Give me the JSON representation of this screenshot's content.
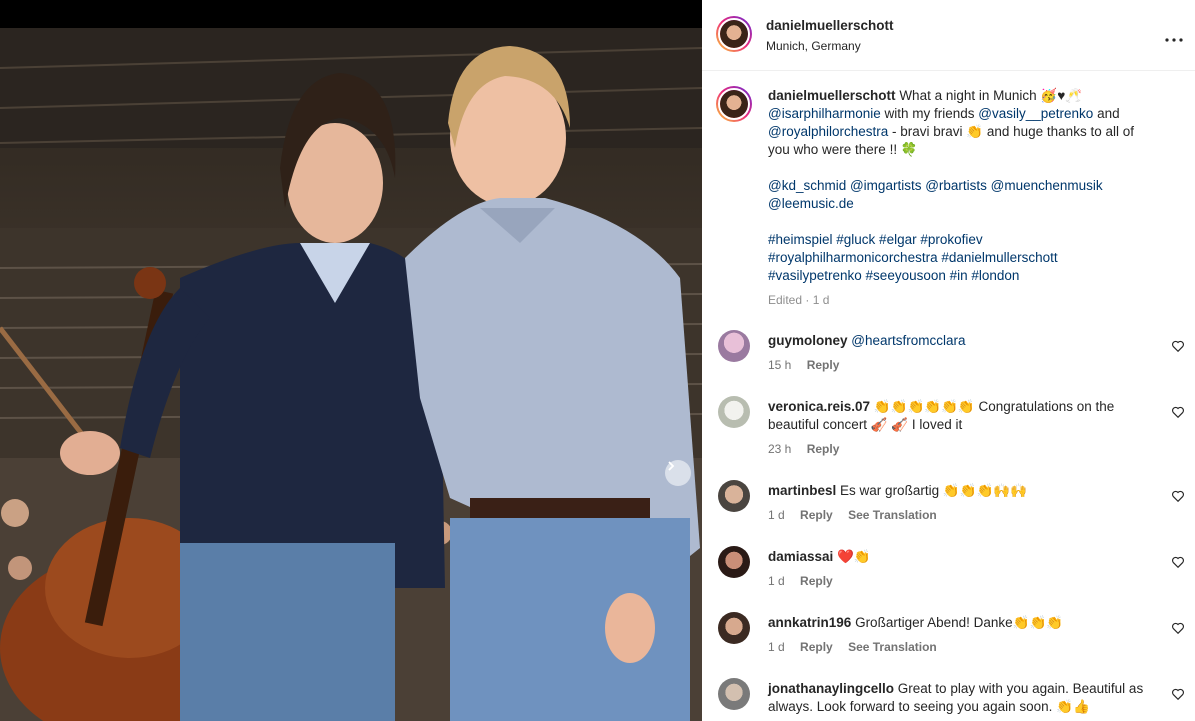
{
  "post": {
    "username": "danielmuellerschott",
    "location": "Munich, Germany",
    "more_icon": "more-horizontal-icon",
    "caption": {
      "username": "danielmuellerschott",
      "line1_text": "What a night in Munich",
      "line1_emoji": "🥳♥🥂",
      "mention_isar": "@isarphilharmonie",
      "with_friends": " with my friends ",
      "mention_vasily": "@vasily__petrenko",
      "and": " and",
      "mention_rpo": "@royalphilorchestra",
      "bravi": " - bravi bravi ",
      "clap": "👏",
      "huge_thanks": " and huge thanks to all of",
      "line4": "you who were there !! ",
      "clover": "🍀",
      "tags1": "@kd_schmid @imgartists @rbartists @muenchenmusik",
      "tags2": "@leemusic.de",
      "hashtags1": "#heimspiel #gluck #elgar #prokofiev",
      "hashtags2": "#royalphilharmonicorchestra #danielmullerschott",
      "hashtags3": "#vasilypetrenko #seeyousoon #in #london",
      "edited": "Edited · 1 d"
    }
  },
  "comments": [
    {
      "user": "guymoloney",
      "text_mention": "@heartsfromcclara",
      "text": "",
      "time": "15 h",
      "reply": "Reply",
      "translate": ""
    },
    {
      "user": "veronica.reis.07",
      "text": "👏👏👏👏👏👏 Congratulations on the",
      "text2": "beautiful concert 🎻 🎻 I loved it",
      "time": "23 h",
      "reply": "Reply",
      "translate": ""
    },
    {
      "user": "martinbesl",
      "text": "Es war großartig 👏👏👏🙌🙌",
      "time": "1 d",
      "reply": "Reply",
      "translate": "See Translation"
    },
    {
      "user": "damiassai",
      "text": "❤️👏",
      "time": "1 d",
      "reply": "Reply",
      "translate": ""
    },
    {
      "user": "annkatrin196",
      "text": "Großartiger Abend! Danke👏👏👏",
      "time": "1 d",
      "reply": "Reply",
      "translate": "See Translation"
    },
    {
      "user": "jonathanaylingcello",
      "text": "Great to play with you again. Beautiful as",
      "text2": "always. Look forward to seeing you again soon. 👏👍",
      "time": "",
      "reply": "",
      "translate": ""
    }
  ],
  "carousel": {
    "next_icon": "chevron-right-icon"
  },
  "colors": {
    "mention": "#00376b",
    "meta": "#8e8e8e",
    "text": "#262626"
  }
}
